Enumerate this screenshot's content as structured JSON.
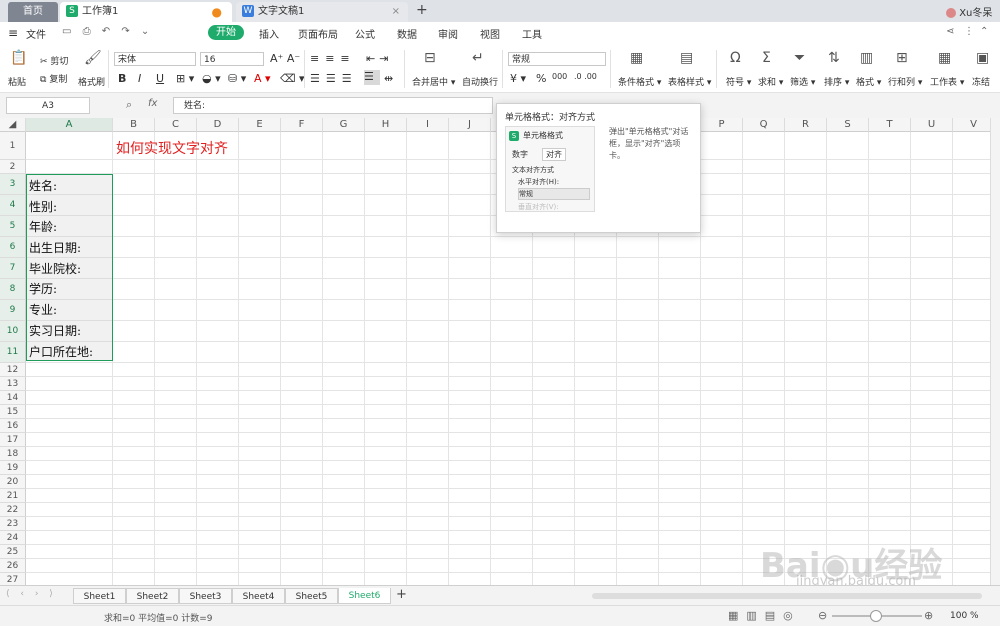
{
  "tabs": {
    "home": "首页",
    "workbook": "工作簿1",
    "document": "文字文稿1",
    "user": "Xu冬呆"
  },
  "menu": {
    "file": "文件",
    "items": [
      "开始",
      "插入",
      "页面布局",
      "公式",
      "数据",
      "审阅",
      "视图",
      "工具"
    ]
  },
  "ribbon": {
    "paste": "粘贴",
    "cut": "剪切",
    "copy": "复制",
    "format_painter": "格式刷",
    "font_name": "宋体",
    "font_size": "16",
    "bold": "B",
    "italic": "I",
    "underline": "U",
    "merge_center": "合并居中",
    "auto_wrap": "自动换行",
    "number_format": "常规",
    "percent": "%",
    "conditional_format": "条件格式",
    "table_style": "表格样式",
    "symbol": "符号",
    "sum": "求和",
    "filter": "筛选",
    "sort": "排序",
    "format": "格式",
    "row_col": "行和列",
    "worksheet": "工作表",
    "freeze": "冻结"
  },
  "formula_bar": {
    "cell_ref": "A3",
    "fx": "fx",
    "content": "姓名:"
  },
  "grid": {
    "columns": [
      "A",
      "B",
      "C",
      "D",
      "E",
      "F",
      "G",
      "H",
      "I",
      "J",
      "K",
      "L",
      "M",
      "N",
      "O",
      "P",
      "Q",
      "R",
      "S",
      "T",
      "U",
      "V"
    ],
    "rows": [
      "1",
      "2",
      "3",
      "4",
      "5",
      "6",
      "7",
      "8",
      "9",
      "10",
      "11",
      "12",
      "13",
      "14",
      "15",
      "16",
      "17",
      "18",
      "19",
      "20",
      "21",
      "22",
      "23",
      "24",
      "25",
      "26",
      "27"
    ],
    "title_cell": "如何实现文字对齐",
    "labels": [
      "姓名:",
      "性别:",
      "年龄:",
      "出生日期:",
      "毕业院校:",
      "学历:",
      "专业:",
      "实习日期:",
      "户口所在地:"
    ]
  },
  "tooltip": {
    "title": "单元格格式：对齐方式",
    "dialog_title": "单元格格式",
    "tab_number": "数字",
    "tab_align": "对齐",
    "section": "文本对齐方式",
    "horizontal": "水平对齐(H):",
    "horizontal_value": "常规",
    "vertical": "垂直对齐(V):",
    "description": "弹出\"单元格格式\"对话框，显示\"对齐\"选项卡。"
  },
  "sheets": [
    "Sheet1",
    "Sheet2",
    "Sheet3",
    "Sheet4",
    "Sheet5",
    "Sheet6"
  ],
  "active_sheet": "Sheet6",
  "status": {
    "stats": "求和=0  平均值=0  计数=9",
    "zoom": "100 %"
  },
  "colors": {
    "accent": "#1fab6b",
    "title_red": "#e02020",
    "selection": "#1f9c5a"
  },
  "watermark": "Baidu经验 jingyan.baidu.com"
}
